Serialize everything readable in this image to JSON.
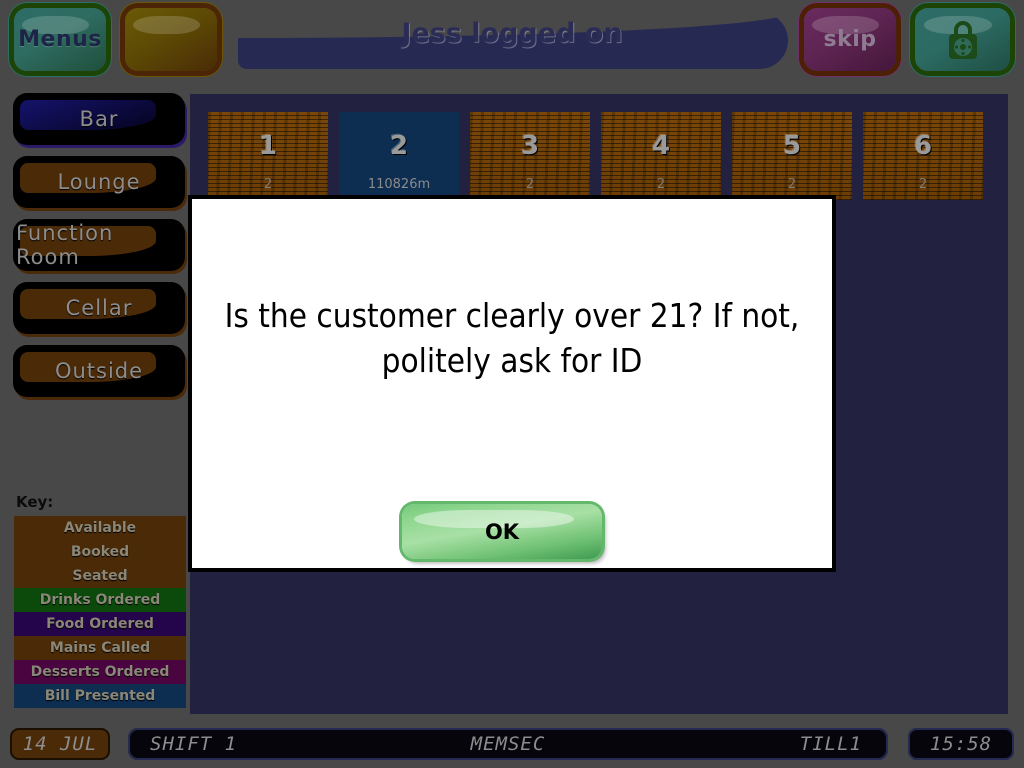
{
  "header": {
    "title": "Jess logged on",
    "buttons": [
      {
        "id": "menus",
        "label": "Menus",
        "icon": "menus-button"
      },
      {
        "id": "blank",
        "label": "",
        "icon": "blank-button"
      },
      {
        "id": "skip",
        "label": "skip",
        "icon": "skip-button"
      },
      {
        "id": "lock",
        "label": "",
        "icon": "padlock-icon"
      }
    ]
  },
  "sidebar": {
    "rooms": [
      {
        "label": "Bar",
        "active": true
      },
      {
        "label": "Lounge",
        "active": false
      },
      {
        "label": "Function Room",
        "active": false
      },
      {
        "label": "Cellar",
        "active": false
      },
      {
        "label": "Outside",
        "active": false
      }
    ],
    "key_label": "Key:",
    "key": [
      {
        "label": "Available",
        "color": "#4b2a08"
      },
      {
        "label": "Booked",
        "color": "#4b2a08"
      },
      {
        "label": "Seated",
        "color": "#4b2a08"
      },
      {
        "label": "Drinks Ordered",
        "color": "#0b4a0b"
      },
      {
        "label": "Food Ordered",
        "color": "#24044a"
      },
      {
        "label": "Mains Called",
        "color": "#4b2a08"
      },
      {
        "label": "Desserts Ordered",
        "color": "#4a0540"
      },
      {
        "label": "Bill Presented",
        "color": "#0d2e51"
      }
    ]
  },
  "main": {
    "tables": [
      {
        "number": "1",
        "detail": "2",
        "status": "available"
      },
      {
        "number": "2",
        "detail": "110826m",
        "status": "bill-presented"
      },
      {
        "number": "3",
        "detail": "2",
        "status": "available"
      },
      {
        "number": "4",
        "detail": "2",
        "status": "available"
      },
      {
        "number": "5",
        "detail": "2",
        "status": "available"
      },
      {
        "number": "6",
        "detail": "2",
        "status": "available"
      }
    ]
  },
  "modal": {
    "message": "Is the customer clearly over 21? If not, politely ask for ID",
    "ok_label": "OK"
  },
  "statusbar": {
    "date": "14 JUL",
    "shift": "SHIFT 1",
    "app": "MEMSEC",
    "till": "TILL1",
    "time": "15:58"
  },
  "colors": {
    "background": "#484848",
    "main_panel": "#222240",
    "banner": "#262a52",
    "wood": "#6b3d06",
    "bill_presented": "#0d2e51",
    "ok_green": "#74c97b"
  }
}
